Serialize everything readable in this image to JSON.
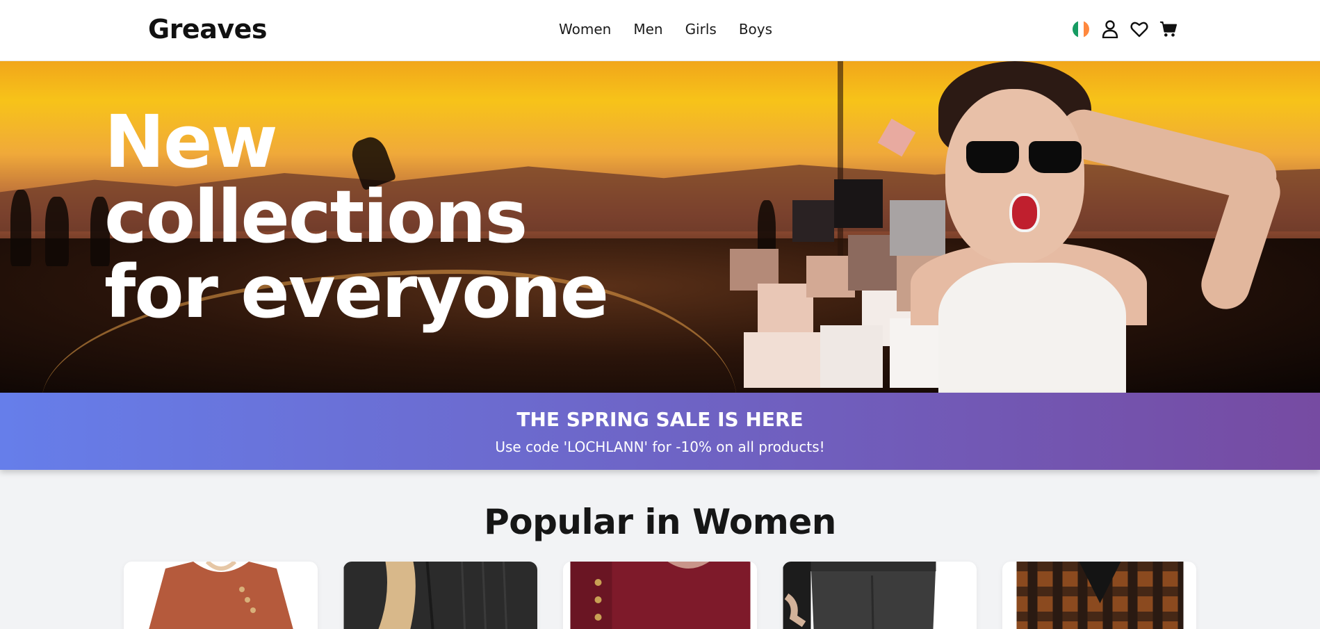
{
  "header": {
    "logo": "Greaves",
    "nav": [
      "Women",
      "Men",
      "Girls",
      "Boys"
    ],
    "icons": [
      "ireland-flag-icon",
      "user-icon",
      "heart-icon",
      "cart-icon"
    ]
  },
  "hero": {
    "title_lines": [
      "New",
      "collections",
      "for everyone"
    ]
  },
  "sale_banner": {
    "title": "THE SPRING SALE IS HERE",
    "subtitle": "Use code 'LOCHLANN' for -10% on all products!",
    "gradient": [
      "#667eea",
      "#764ba2"
    ]
  },
  "popular": {
    "title": "Popular in Women",
    "products": [
      {
        "image": "rust-ribbed-sweater",
        "color": "#b55a3c"
      },
      {
        "image": "black-knit-cardigan",
        "color": "#2b2b2b"
      },
      {
        "image": "burgundy-button-top",
        "color": "#7e1a2a"
      },
      {
        "image": "grey-trousers",
        "color": "#3c3c3c"
      },
      {
        "image": "plaid-shirt",
        "color": "#8b4a1f"
      }
    ]
  }
}
